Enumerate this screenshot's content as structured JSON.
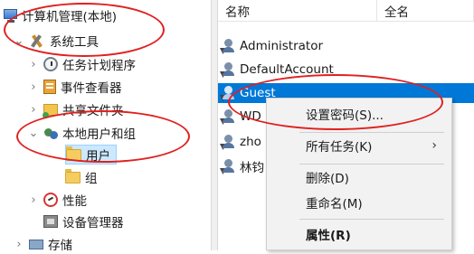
{
  "tree": {
    "root": "计算机管理(本地)",
    "system_tools": "系统工具",
    "task_scheduler": "任务计划程序",
    "event_viewer": "事件查看器",
    "shared_folders": "共享文件夹",
    "local_users_groups": "本地用户和组",
    "users": "用户",
    "groups": "组",
    "performance": "性能",
    "device_manager": "设备管理器",
    "storage": "存储"
  },
  "list": {
    "columns": [
      "名称",
      "全名"
    ],
    "users": [
      "Administrator",
      "DefaultAccount",
      "Guest",
      "WD",
      "zho",
      "林钧"
    ]
  },
  "context_menu": {
    "set_password": "设置密码(S)...",
    "all_tasks": "所有任务(K)",
    "delete": "删除(D)",
    "rename": "重命名(M)",
    "properties": "属性(R)"
  },
  "icons": {
    "chevron_right": "›",
    "chevron_down": "⌄",
    "submenu_arrow": "›"
  },
  "colors": {
    "selection": "#0078d7",
    "annotation": "#e02020",
    "tree_selection": "#cce8ff"
  }
}
